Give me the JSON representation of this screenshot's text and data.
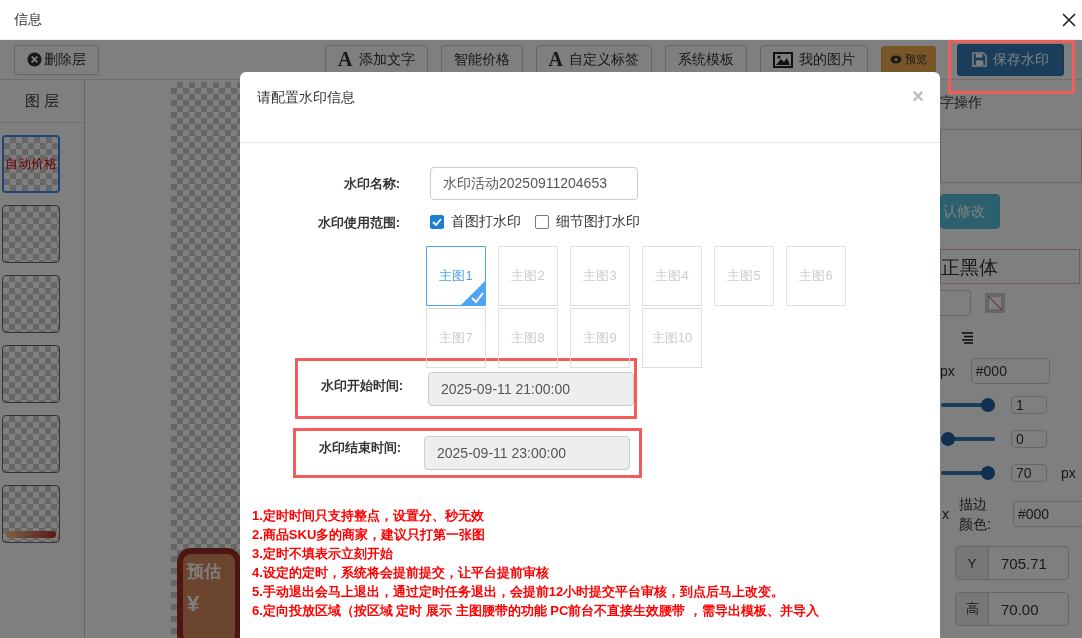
{
  "window": {
    "title": "信息"
  },
  "toolbar": {
    "delete_button": "删除层",
    "buttons": [
      {
        "label": "添加文字",
        "kind": "letter",
        "glyph": "A"
      },
      {
        "label": "智能价格",
        "kind": "plain"
      },
      {
        "label": "自定义标签",
        "kind": "letter",
        "glyph": "A"
      },
      {
        "label": "系统模板",
        "kind": "plain"
      },
      {
        "label": "我的图片",
        "kind": "image"
      }
    ],
    "preview_button": "预览",
    "save_button": {
      "label": "保存水印",
      "highlighted": true
    }
  },
  "layers": {
    "title": "图 层",
    "items": [
      {
        "kind": "text",
        "text": "自动价格",
        "selected": true
      },
      {
        "kind": "blank",
        "selected": false
      },
      {
        "kind": "blank",
        "selected": false
      },
      {
        "kind": "blank",
        "selected": false
      },
      {
        "kind": "blank",
        "selected": false
      },
      {
        "kind": "banner",
        "selected": false
      }
    ]
  },
  "canvas": {
    "tag_title": "预估",
    "tag_currency": "¥"
  },
  "right_panel": {
    "section_title": "字操作",
    "confirm_button": "认修改",
    "font_name": "正黑体",
    "size_unit": "px",
    "text_color": "#000",
    "sliders": [
      {
        "level": 1,
        "value": "1"
      },
      {
        "level": 0,
        "value": "0"
      },
      {
        "level": 1,
        "value": "70",
        "unit": "px"
      }
    ],
    "stroke_prefix": "x",
    "stroke_label": "描边颜色:",
    "stroke_color": "#000",
    "y_label": "Y",
    "y_value": "705.71",
    "h_label": "高",
    "h_value": "70.00"
  },
  "dialog": {
    "title": "请配置水印信息",
    "close": "×",
    "name_label": "水印名称:",
    "name_value": "水印活动20250911204653",
    "scope_label": "水印使用范围:",
    "scope_options": [
      {
        "label": "首图打水印",
        "checked": true
      },
      {
        "label": "细节图打水印",
        "checked": false
      }
    ],
    "images": [
      {
        "label": "主图1",
        "selected": true
      },
      {
        "label": "主图2",
        "selected": false
      },
      {
        "label": "主图3",
        "selected": false
      },
      {
        "label": "主图4",
        "selected": false
      },
      {
        "label": "主图5",
        "selected": false
      },
      {
        "label": "主图6",
        "selected": false
      },
      {
        "label": "主图7",
        "selected": false
      },
      {
        "label": "主图8",
        "selected": false
      },
      {
        "label": "主图9",
        "selected": false
      },
      {
        "label": "主图10",
        "selected": false
      }
    ],
    "time_fields": [
      {
        "label": "水印开始时间:",
        "value": "2025-09-11 21:00:00",
        "highlighted": true
      },
      {
        "label": "水印结束时间:",
        "value": "2025-09-11 23:00:00",
        "highlighted": true
      }
    ],
    "notes": [
      "1.定时时间只支持整点，设置分、秒无效",
      "2.商品SKU多的商家，建议只打第一张图",
      "3.定时不填表示立刻开始",
      "4.设定的定时，系统将会提前提交，让平台提前审核",
      "5.手动退出会马上退出，通过定时任务退出，会提前12小时提交平台审核，到点后马上改变。",
      "6.定向投放区域（按区域 定时 展示 主图腰带的功能 PC前台不直接生效腰带 ，需导出模板、并导入"
    ]
  }
}
